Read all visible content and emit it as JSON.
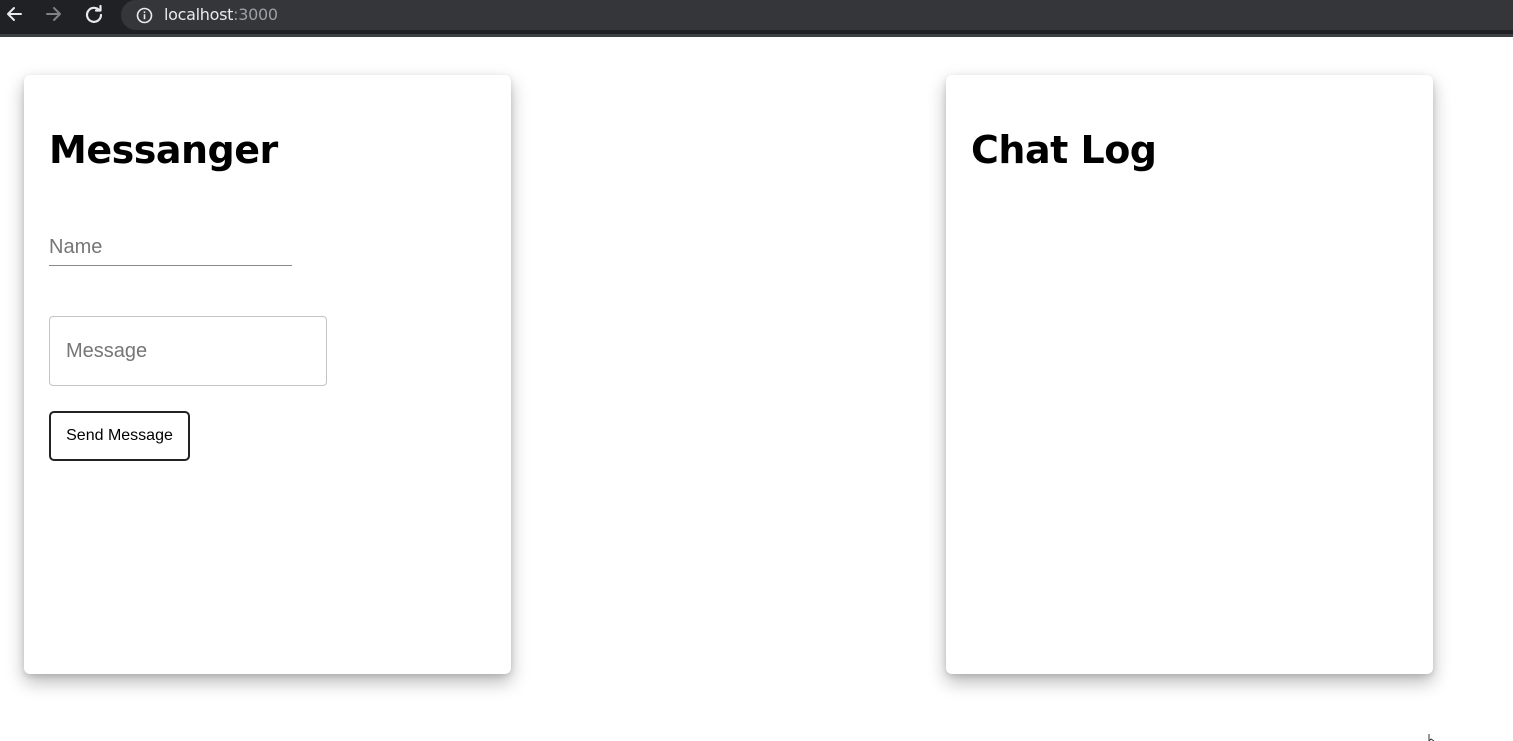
{
  "browser": {
    "url_host": "localhost",
    "url_port": ":3000",
    "icons": {
      "back": "arrow-left-icon",
      "forward": "arrow-right-icon",
      "reload": "reload-icon",
      "site_info": "info-icon"
    }
  },
  "messenger": {
    "title": "Messanger",
    "name_placeholder": "Name",
    "name_value": "",
    "message_placeholder": "Message",
    "message_value": "",
    "send_label": "Send Message"
  },
  "chat_log": {
    "title": "Chat Log",
    "messages": []
  },
  "colors": {
    "chrome_bar": "#202124",
    "omnibox": "#35363a",
    "page_background": "#ffffff",
    "card_background": "#ffffff",
    "text": "#000000",
    "placeholder": "#767676"
  }
}
